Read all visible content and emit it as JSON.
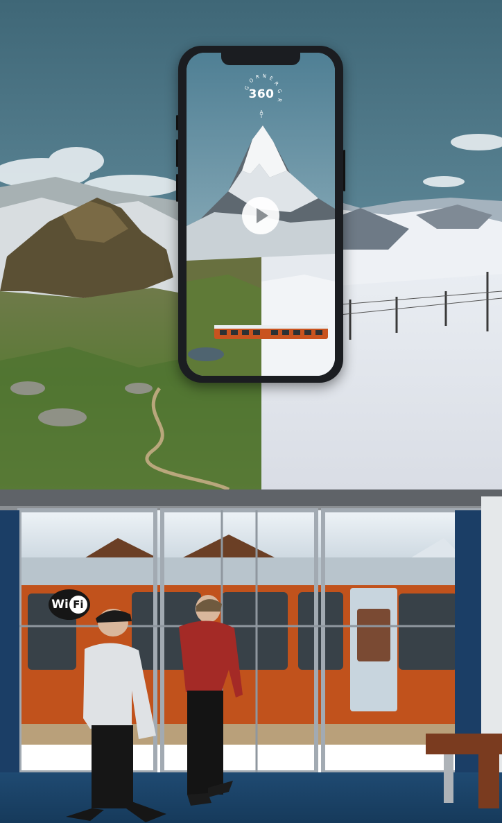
{
  "promo": {
    "logo_text": "360",
    "logo_ring_text": "GORNERGRAT"
  },
  "station": {
    "wifi_label": "Wi",
    "wifi_label_suffix": "Fi"
  }
}
